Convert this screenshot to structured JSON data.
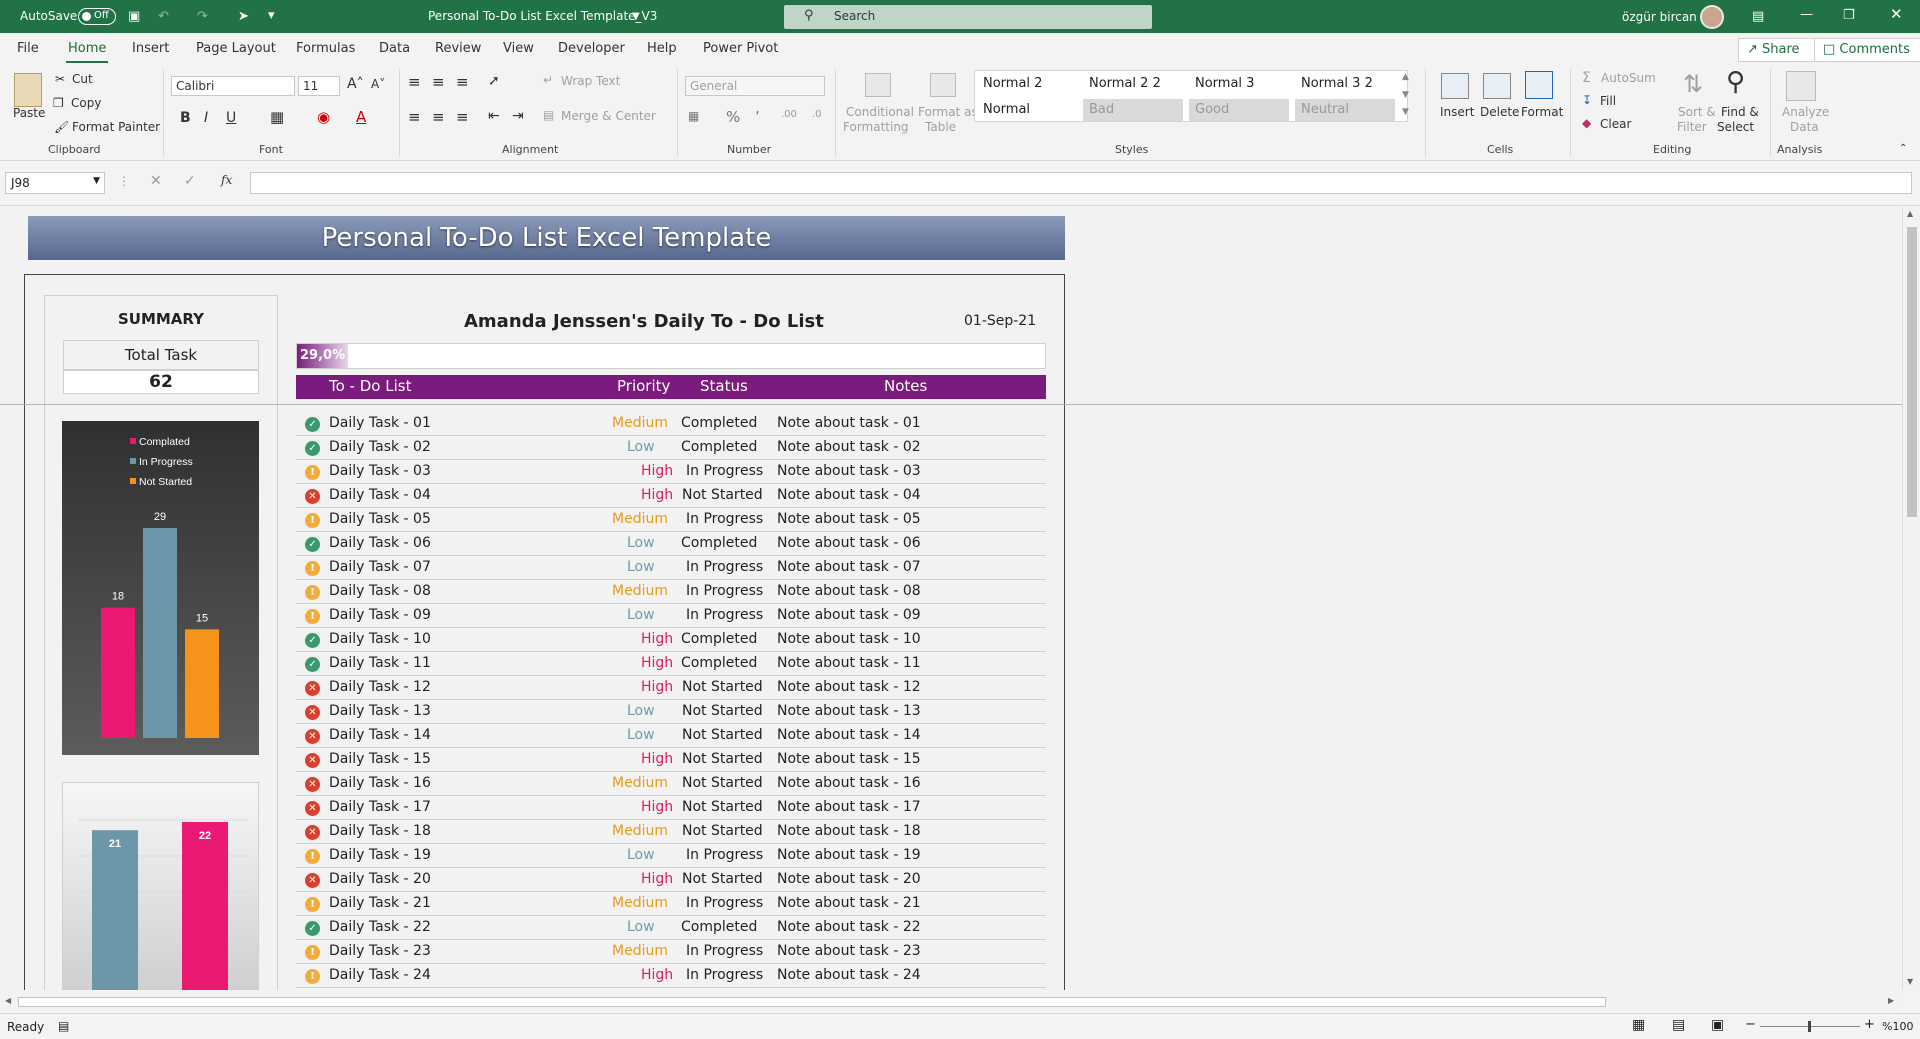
{
  "titlebar": {
    "autosave": "AutoSave",
    "toggle": "Off",
    "title": "Personal To-Do List Excel Template_V3",
    "search": "Search",
    "user": "özgür bircan"
  },
  "tabs": [
    "File",
    "Home",
    "Insert",
    "Page Layout",
    "Formulas",
    "Data",
    "Review",
    "View",
    "Developer",
    "Help",
    "Power Pivot"
  ],
  "share": "Share",
  "comments": "Comments",
  "ribbon": {
    "clipboard": {
      "paste": "Paste",
      "cut": "Cut",
      "copy": "Copy",
      "format_painter": "Format Painter",
      "label": "Clipboard"
    },
    "font": {
      "name": "Calibri",
      "size": "11",
      "label": "Font"
    },
    "alignment": {
      "wrap": "Wrap Text",
      "merge": "Merge & Center",
      "label": "Alignment"
    },
    "number": {
      "format": "General",
      "label": "Number"
    },
    "styles": {
      "cond1": "Conditional",
      "cond2": "Formatting",
      "table1": "Format as",
      "table2": "Table",
      "cells": [
        "Normal 2",
        "Normal 2 2",
        "Normal 3",
        "Normal 3 2",
        "Normal",
        "Bad",
        "Good",
        "Neutral"
      ],
      "label": "Styles"
    },
    "cells": {
      "insert": "Insert",
      "delete": "Delete",
      "format": "Format",
      "label": "Cells"
    },
    "editing": {
      "autosum": "AutoSum",
      "fill": "Fill",
      "clear": "Clear",
      "sort1": "Sort &",
      "sort2": "Filter",
      "find1": "Find &",
      "find2": "Select",
      "label": "Editing"
    },
    "analysis": {
      "a1": "Analyze",
      "a2": "Data",
      "label": "Analysis"
    }
  },
  "formula_bar": {
    "cell": "J98",
    "fx": "fx",
    "value": ""
  },
  "sheet": {
    "banner": "Personal To-Do List Excel Template",
    "summary_title": "SUMMARY",
    "total_label": "Total Task",
    "total_value": "62",
    "list_title": "Amanda Jenssen's Daily To - Do List",
    "date": "01-Sep-21",
    "progress_label": "29,0%",
    "progress_value": 0.29,
    "headers": {
      "todo": "To - Do List",
      "priority": "Priority",
      "status": "Status",
      "notes": "Notes"
    },
    "colors": {
      "completed": "#3a9a6c",
      "progress": "#f0ad3c",
      "notstarted": "#d8412f",
      "high": "#e0195f",
      "medium": "#ee9a1a",
      "low": "#6e9bab",
      "header": "#7b1b7e"
    },
    "tasks": [
      {
        "name": "Daily Task - 01",
        "priority": "Medium",
        "status": "Completed",
        "notes": "Note about task - 01"
      },
      {
        "name": "Daily Task - 02",
        "priority": "Low",
        "status": "Completed",
        "notes": "Note about task - 02"
      },
      {
        "name": "Daily Task - 03",
        "priority": "High",
        "status": "In Progress",
        "notes": "Note about task - 03"
      },
      {
        "name": "Daily Task - 04",
        "priority": "High",
        "status": "Not Started",
        "notes": "Note about task - 04"
      },
      {
        "name": "Daily Task - 05",
        "priority": "Medium",
        "status": "In Progress",
        "notes": "Note about task - 05"
      },
      {
        "name": "Daily Task - 06",
        "priority": "Low",
        "status": "Completed",
        "notes": "Note about task - 06"
      },
      {
        "name": "Daily Task - 07",
        "priority": "Low",
        "status": "In Progress",
        "notes": "Note about task - 07"
      },
      {
        "name": "Daily Task - 08",
        "priority": "Medium",
        "status": "In Progress",
        "notes": "Note about task - 08"
      },
      {
        "name": "Daily Task - 09",
        "priority": "Low",
        "status": "In Progress",
        "notes": "Note about task - 09"
      },
      {
        "name": "Daily Task - 10",
        "priority": "High",
        "status": "Completed",
        "notes": "Note about task - 10"
      },
      {
        "name": "Daily Task - 11",
        "priority": "High",
        "status": "Completed",
        "notes": "Note about task - 11"
      },
      {
        "name": "Daily Task - 12",
        "priority": "High",
        "status": "Not Started",
        "notes": "Note about task - 12"
      },
      {
        "name": "Daily Task - 13",
        "priority": "Low",
        "status": "Not Started",
        "notes": "Note about task - 13"
      },
      {
        "name": "Daily Task - 14",
        "priority": "Low",
        "status": "Not Started",
        "notes": "Note about task - 14"
      },
      {
        "name": "Daily Task - 15",
        "priority": "High",
        "status": "Not Started",
        "notes": "Note about task - 15"
      },
      {
        "name": "Daily Task - 16",
        "priority": "Medium",
        "status": "Not Started",
        "notes": "Note about task - 16"
      },
      {
        "name": "Daily Task - 17",
        "priority": "High",
        "status": "Not Started",
        "notes": "Note about task - 17"
      },
      {
        "name": "Daily Task - 18",
        "priority": "Medium",
        "status": "Not Started",
        "notes": "Note about task - 18"
      },
      {
        "name": "Daily Task - 19",
        "priority": "Low",
        "status": "In Progress",
        "notes": "Note about task - 19"
      },
      {
        "name": "Daily Task - 20",
        "priority": "High",
        "status": "Not Started",
        "notes": "Note about task - 20"
      },
      {
        "name": "Daily Task - 21",
        "priority": "Medium",
        "status": "In Progress",
        "notes": "Note about task - 21"
      },
      {
        "name": "Daily Task - 22",
        "priority": "Low",
        "status": "Completed",
        "notes": "Note about task - 22"
      },
      {
        "name": "Daily Task - 23",
        "priority": "Medium",
        "status": "In Progress",
        "notes": "Note about task - 23"
      },
      {
        "name": "Daily Task - 24",
        "priority": "High",
        "status": "In Progress",
        "notes": "Note about task - 24"
      }
    ]
  },
  "chart_data": [
    {
      "type": "bar",
      "categories": [
        "Complated",
        "In Progress",
        "Not Started"
      ],
      "values": [
        18,
        29,
        15
      ],
      "legend": "top-left",
      "colors": [
        "#ea1a73",
        "#6c97a8",
        "#f6931b"
      ]
    },
    {
      "type": "bar",
      "categories": [
        "",
        "",
        ""
      ],
      "values": [
        21,
        0,
        22
      ],
      "colors": [
        "#6c97a8",
        "#f6931b",
        "#ea1a73"
      ]
    }
  ],
  "status": {
    "ready": "Ready",
    "zoom": "%100"
  }
}
